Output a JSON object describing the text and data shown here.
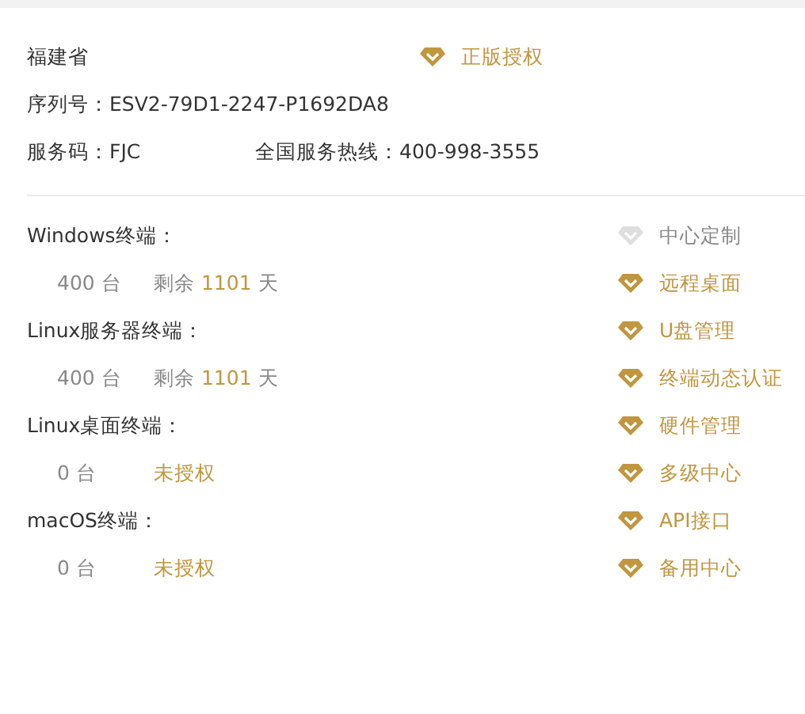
{
  "license": {
    "province": "福建省",
    "badge": "正版授权",
    "serial_label": "序列号：",
    "serial": "ESV2-79D1-2247-P1692DA8",
    "service_label": "服务码：",
    "service_code": "FJC",
    "hotline_label": "全国服务热线：",
    "hotline": "400-998-3555"
  },
  "terminals": [
    {
      "name": "Windows终端：",
      "count": "400 台",
      "kind": "licensed",
      "prefix": "剩余",
      "days": "1101",
      "unit": "天"
    },
    {
      "name": "Linux服务器终端：",
      "count": "400 台",
      "kind": "licensed",
      "prefix": "剩余",
      "days": "1101",
      "unit": "天"
    },
    {
      "name": "Linux桌面终端：",
      "count": "0 台",
      "kind": "unlicensed",
      "status": "未授权"
    },
    {
      "name": "macOS终端：",
      "count": "0 台",
      "kind": "unlicensed",
      "status": "未授权"
    }
  ],
  "features": [
    {
      "label": "中心定制",
      "enabled": false
    },
    {
      "label": "远程桌面",
      "enabled": true
    },
    {
      "label": "U盘管理",
      "enabled": true
    },
    {
      "label": "终端动态认证",
      "enabled": true
    },
    {
      "label": "硬件管理",
      "enabled": true
    },
    {
      "label": "多级中心",
      "enabled": true
    },
    {
      "label": "API接口",
      "enabled": true
    },
    {
      "label": "备用中心",
      "enabled": true
    }
  ]
}
